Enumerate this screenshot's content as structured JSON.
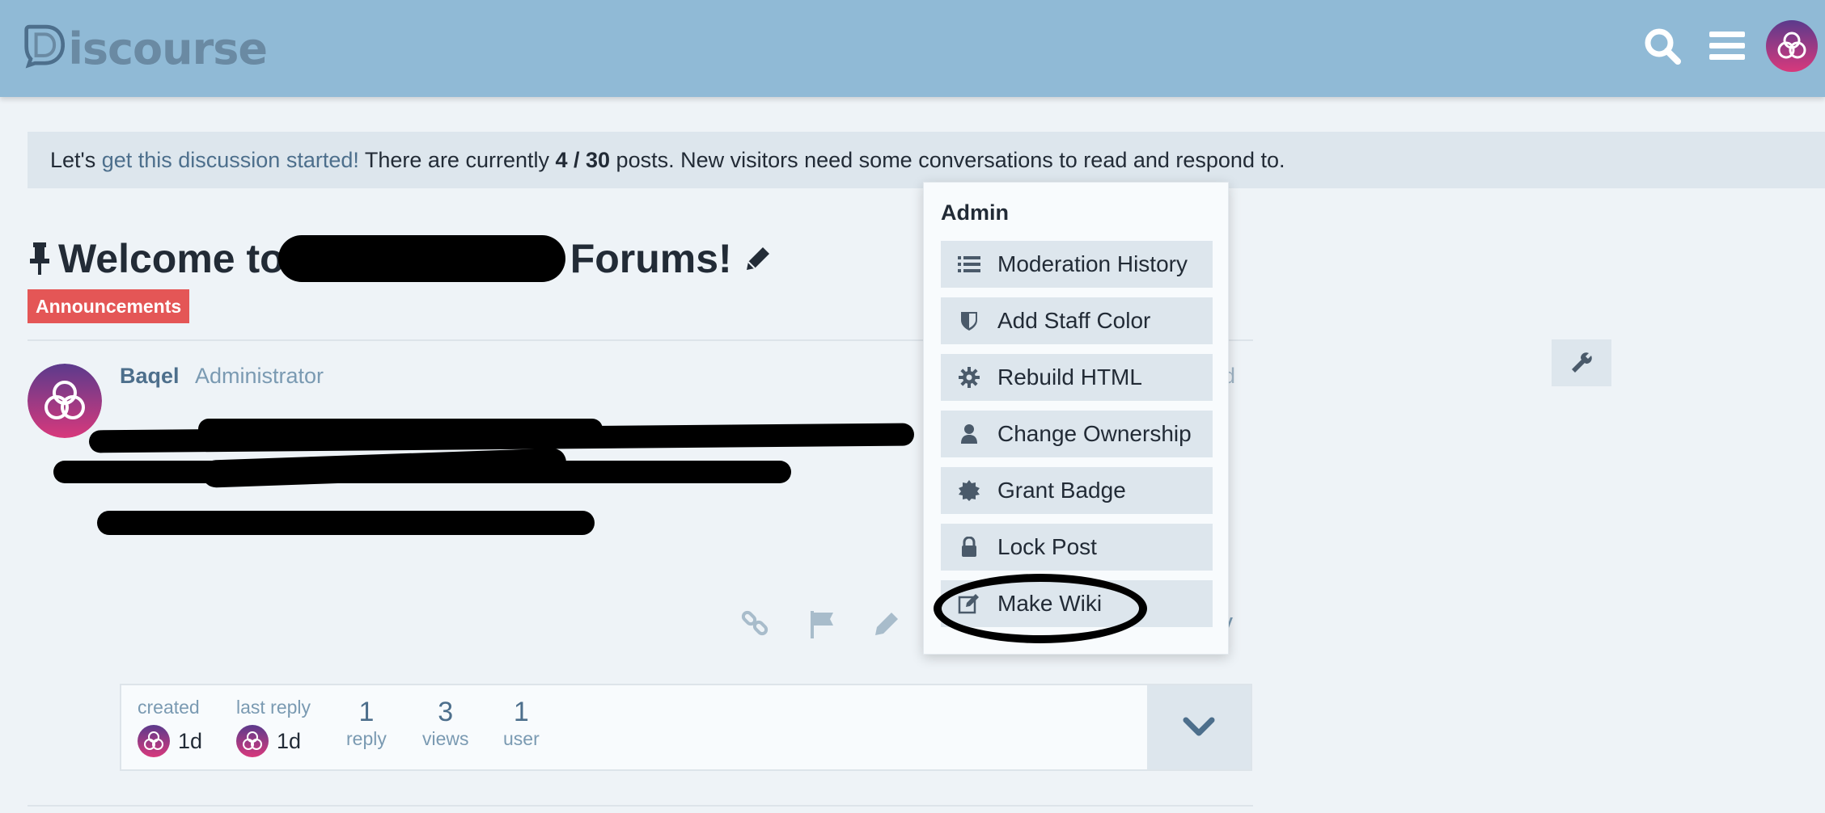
{
  "header": {
    "logo_text": "iscourse",
    "icons": [
      "search-icon",
      "hamburger-menu-icon",
      "user-avatar"
    ]
  },
  "banner": {
    "prefix": "Let's ",
    "link": "get this discussion started!",
    "middle": " There are currently ",
    "count": "4 / 30",
    "suffix": " posts. New visitors need some conversations to read and respond to."
  },
  "topic": {
    "title_start": "Welcome to",
    "title_end": "Forums!",
    "category": "Announcements"
  },
  "post": {
    "username": "Baqel",
    "user_title": "Administrator",
    "date_fragment": "d",
    "reply_fragment": "y"
  },
  "admin_menu": {
    "title": "Admin",
    "items": [
      {
        "label": "Moderation History",
        "icon": "list-icon"
      },
      {
        "label": "Add Staff Color",
        "icon": "shield-icon"
      },
      {
        "label": "Rebuild HTML",
        "icon": "gear-icon"
      },
      {
        "label": "Change Ownership",
        "icon": "user-icon"
      },
      {
        "label": "Grant Badge",
        "icon": "badge-icon"
      },
      {
        "label": "Lock Post",
        "icon": "lock-icon"
      },
      {
        "label": "Make Wiki",
        "icon": "pencil-square-icon"
      }
    ]
  },
  "topic_map": {
    "created_label": "created",
    "created_time": "1d",
    "last_reply_label": "last reply",
    "last_reply_time": "1d",
    "replies_num": "1",
    "replies_label": "reply",
    "views_num": "3",
    "views_label": "views",
    "users_num": "1",
    "users_label": "user"
  },
  "colors": {
    "header_bg": "#90bad6",
    "category": "#e45656",
    "link": "#4d6f8c"
  }
}
